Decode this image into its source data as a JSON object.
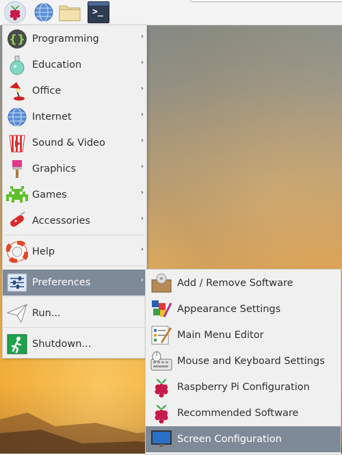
{
  "panel": {
    "icons": [
      "raspberry-menu-icon",
      "web-browser-icon",
      "file-manager-icon",
      "terminal-icon"
    ],
    "terminal_glyph": ">_"
  },
  "main_menu": {
    "items": [
      {
        "label": "Programming",
        "icon": "programming-icon",
        "has_submenu": true
      },
      {
        "label": "Education",
        "icon": "education-icon",
        "has_submenu": true
      },
      {
        "label": "Office",
        "icon": "office-icon",
        "has_submenu": true
      },
      {
        "label": "Internet",
        "icon": "internet-icon",
        "has_submenu": true
      },
      {
        "label": "Sound & Video",
        "icon": "sound-video-icon",
        "has_submenu": true
      },
      {
        "label": "Graphics",
        "icon": "graphics-icon",
        "has_submenu": true
      },
      {
        "label": "Games",
        "icon": "games-icon",
        "has_submenu": true
      },
      {
        "label": "Accessories",
        "icon": "accessories-icon",
        "has_submenu": true
      },
      {
        "label": "Help",
        "icon": "help-icon",
        "has_submenu": true
      },
      {
        "label": "Preferences",
        "icon": "preferences-icon",
        "has_submenu": true,
        "selected": true
      },
      {
        "label": "Run...",
        "icon": "run-icon",
        "has_submenu": false
      },
      {
        "label": "Shutdown...",
        "icon": "shutdown-icon",
        "has_submenu": false
      }
    ],
    "submenu_arrow": "›"
  },
  "preferences_menu": {
    "items": [
      {
        "label": "Add / Remove Software",
        "icon": "add-remove-software-icon"
      },
      {
        "label": "Appearance Settings",
        "icon": "appearance-settings-icon"
      },
      {
        "label": "Main Menu Editor",
        "icon": "main-menu-editor-icon"
      },
      {
        "label": "Mouse and Keyboard Settings",
        "icon": "mouse-keyboard-icon"
      },
      {
        "label": "Raspberry Pi Configuration",
        "icon": "raspberry-pi-config-icon"
      },
      {
        "label": "Recommended Software",
        "icon": "recommended-software-icon"
      },
      {
        "label": "Screen Configuration",
        "icon": "screen-configuration-icon",
        "selected": true
      }
    ]
  },
  "colors": {
    "selection": "#7f8a99",
    "menu_background": "#f0f0f0",
    "panel_background": "#f3f3f3"
  }
}
